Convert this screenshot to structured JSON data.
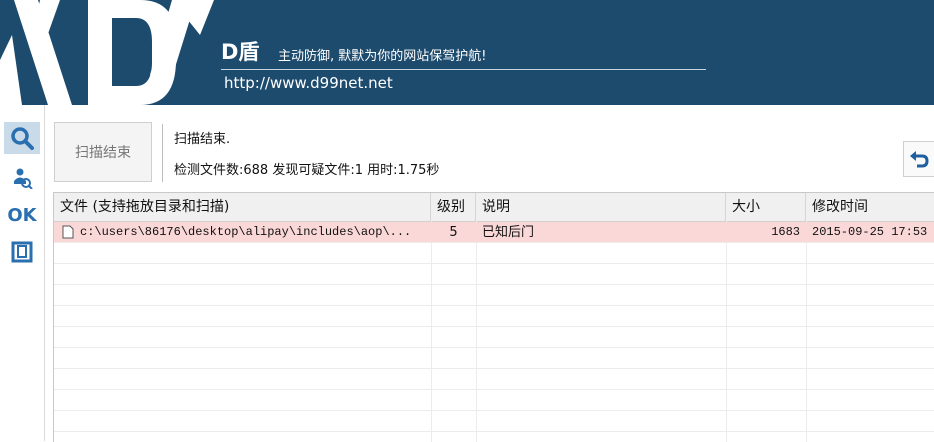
{
  "header": {
    "brand": "D盾",
    "slogan": "主动防御, 默默为你的网站保驾护航!",
    "url": "http://www.d99net.net"
  },
  "sidebar": {
    "items": [
      {
        "icon": "search-icon",
        "active": true
      },
      {
        "icon": "user-scan-icon",
        "active": false
      },
      {
        "icon": "ok-icon",
        "label": "OK",
        "active": false
      },
      {
        "icon": "window-icon",
        "active": false
      }
    ]
  },
  "toolbar": {
    "scan_button_label": "扫描结束",
    "status_title": "扫描结束.",
    "status_detail": "检测文件数:688 发现可疑文件:1 用时:1.75秒"
  },
  "colors": {
    "header_bg": "#1d4b6e",
    "flag_row": "#fbd8d8",
    "accent": "#2a6fb0"
  },
  "table": {
    "columns": [
      "文件 (支持拖放目录和扫描)",
      "级别",
      "说明",
      "大小",
      "修改时间"
    ],
    "rows": [
      {
        "file": "c:\\users\\86176\\desktop\\alipay\\includes\\aop\\...",
        "level": "5",
        "desc": "已知后门",
        "size": "1683",
        "mtime": "2015-09-25 17:53"
      }
    ]
  }
}
